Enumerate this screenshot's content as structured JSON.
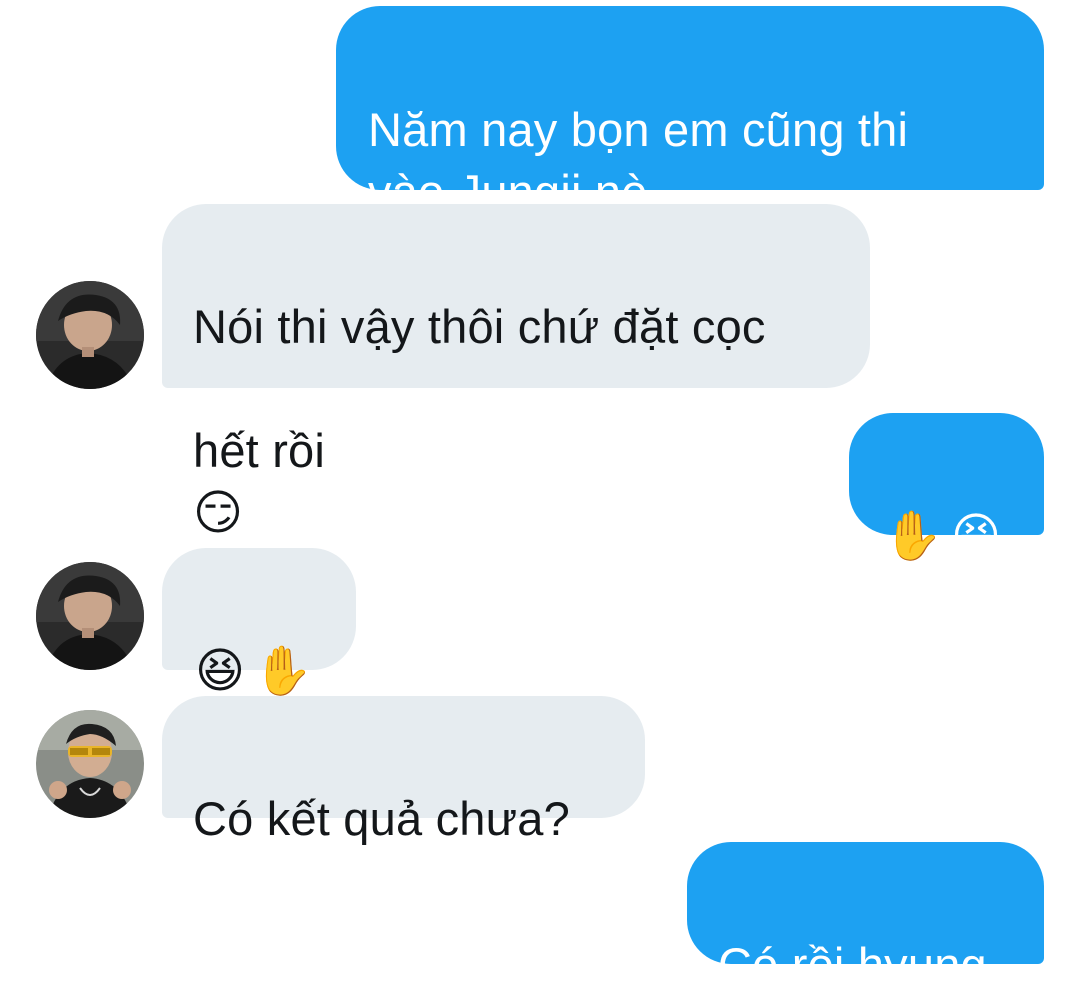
{
  "colors": {
    "outgoing_bubble": "#1da1f2",
    "incoming_bubble": "#e6ecf0",
    "outgoing_text": "#ffffff",
    "incoming_text": "#14171a"
  },
  "messages": [
    {
      "direction": "outgoing",
      "text": "Năm nay bọn em cũng thi\nvào Jungji nè"
    },
    {
      "direction": "incoming",
      "avatar": "user-avatar-1",
      "text_line1": "Nói thi vậy thôi chứ đặt cọc",
      "text_line2": "hết rồi",
      "emoji": "😏"
    },
    {
      "direction": "outgoing",
      "emoji1": "✋",
      "emoji2": "😆"
    },
    {
      "direction": "incoming",
      "avatar": "user-avatar-1",
      "emoji1": "😆",
      "emoji2": "✋"
    },
    {
      "direction": "incoming",
      "avatar": "user-avatar-2",
      "text": "Có kết quả chưa?"
    },
    {
      "direction": "outgoing",
      "text": "Có rồi hyung"
    }
  ]
}
